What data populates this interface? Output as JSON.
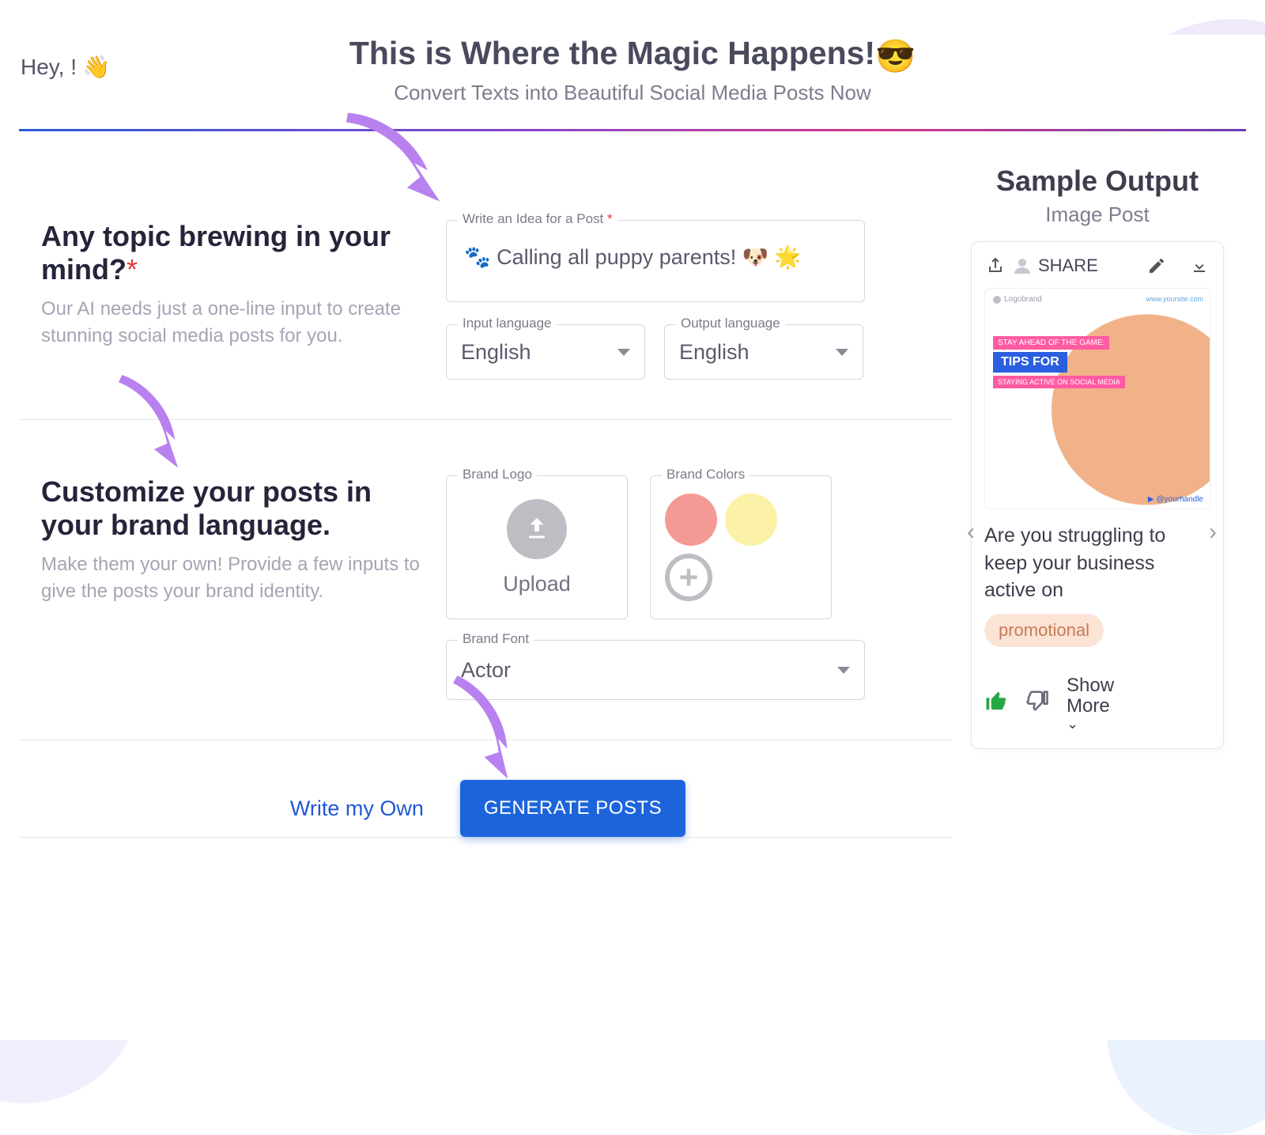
{
  "greeting": "Hey, ! 👋",
  "hero": {
    "title": "This is Where the Magic Happens!",
    "title_emoji": "😎",
    "subtitle": "Convert Texts into Beautiful Social Media Posts Now"
  },
  "section1": {
    "heading": "Any topic brewing in your mind?",
    "desc": "Our AI needs just a one-line input to create stunning social media posts for you.",
    "idea_label": "Write an Idea for a Post",
    "idea_value": "🐾 Calling all puppy parents! 🐶 🌟",
    "input_lang_label": "Input language",
    "input_lang_value": "English",
    "output_lang_label": "Output language",
    "output_lang_value": "English"
  },
  "section2": {
    "heading": "Customize your posts in your brand language.",
    "desc": "Make them your own! Provide a few inputs to give the posts your brand identity.",
    "logo_label": "Brand Logo",
    "upload_label": "Upload",
    "colors_label": "Brand Colors",
    "colors": [
      "#f49a96",
      "#fbf2a8"
    ],
    "font_label": "Brand Font",
    "font_value": "Actor"
  },
  "actions": {
    "write_own": "Write my Own",
    "generate": "GENERATE POSTS"
  },
  "sample": {
    "title": "Sample Output",
    "subtitle": "Image Post",
    "share_label": "SHARE",
    "mock": {
      "logo": "Logobrand",
      "url": "www.yoursite.com",
      "tag1": "STAY AHEAD OF THE GAME:",
      "tag2": "TIPS FOR",
      "tag3": "STAYING ACTIVE ON SOCIAL MEDIA",
      "handle": "▶ @yourhandle"
    },
    "caption": "Are you struggling to keep your business active on",
    "chip": "promotional",
    "show_more": "Show More"
  }
}
